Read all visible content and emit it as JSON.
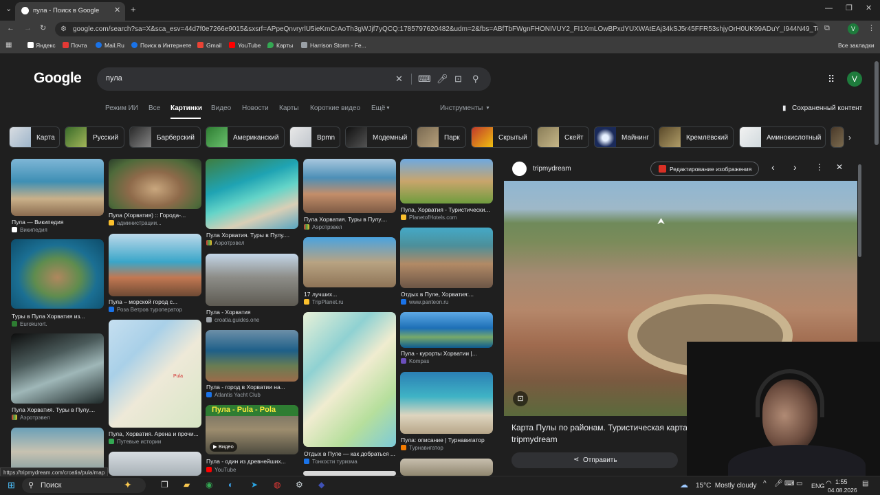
{
  "browser": {
    "tab_title": "пула - Поиск в Google",
    "url": "google.com/search?sa=X&sca_esv=44d7f0e7266e9015&sxsrf=APpeQnvryrlU5ieKmCrAoTh3gWJjf7yQCQ:1785797620482&udm=2&fbs=ABfTbFWgnFHONIVUY2_FI1XmLOwBPxdYUXWAtEAj34kSJ5r45FFR53shjyOrH0UK99ADuY_I944N49_ToyGoquklx6RmNs...",
    "bookmarks": [
      "Яндекс",
      "Почта",
      "Mail.Ru",
      "Поиск в Интернете",
      "Gmail",
      "YouTube",
      "Карты",
      "Harrison Storm - Fe..."
    ],
    "all_bookmarks": "Все закладки",
    "avatar_letter": "V"
  },
  "search": {
    "logo": "Google",
    "query": "пула",
    "tabs": [
      "Режим ИИ",
      "Все",
      "Картинки",
      "Видео",
      "Новости",
      "Карты",
      "Короткие видео",
      "Ещё"
    ],
    "tools": "Инструменты",
    "saved": "Сохраненный контент",
    "chips": [
      "Карта",
      "Русский",
      "Барберский",
      "Американский",
      "Bpmn",
      "Модемный",
      "Парк",
      "Скрытый",
      "Скейт",
      "Майнинг",
      "Кремлёвский",
      "Аминокислотный"
    ]
  },
  "results": [
    {
      "cap": "Пула — Википедия",
      "src": "Википедия"
    },
    {
      "cap": "Туры в Пула Хорватия из...",
      "src": "Eurokurort."
    },
    {
      "cap": "Пула Хорватия. Туры в Пулу....",
      "src": "Аэротрэвел"
    },
    {
      "cap": "Пула (Хорватия) :: Города-...",
      "src": "администрации..."
    },
    {
      "cap": "Пула – морской город с...",
      "src": "Роза Ветров туроператор"
    },
    {
      "cap": "Пула, Хорватия. Арена и прочи...",
      "src": "Путевые истории"
    },
    {
      "cap": "Пула Хорватия. Туры в Пулу....",
      "src": "Аэротрэвел"
    },
    {
      "cap": "Пула - Хорватия",
      "src": "croatia.guides.one"
    },
    {
      "cap": "Пула - город в Хорватии на...",
      "src": "Atlantis Yacht Club"
    },
    {
      "cap": "Пула - один из древнейшиx...",
      "src": "YouTube"
    },
    {
      "cap": "Пула Хорватия. Туры в Пулу....",
      "src": "Аэротрэвел"
    },
    {
      "cap": "17 лучших...",
      "src": "TripPlanet.ru"
    },
    {
      "cap": "Отдых в Пуле — как добраться ...",
      "src": "Тонкости туризма"
    },
    {
      "cap": "Пула, Хорватия - Туристически...",
      "src": "PlanetofHotels.com"
    },
    {
      "cap": "Отдых в Пуле, Хорватия:...",
      "src": "www.panteon.ru"
    },
    {
      "cap": "Пула - курорты Хорватии |...",
      "src": "Kompas"
    },
    {
      "cap": "Пула: описание | Турнавигатор",
      "src": "Турнавигатор"
    }
  ],
  "overlays": {
    "map_label": "Pula",
    "banner": "Пула - Pula - Pola",
    "video": "Видео"
  },
  "panel": {
    "site": "tripmydream",
    "edit": "Редактирование изображения",
    "title": "Карта Пулы по районам. Туристическая карта",
    "subtitle": "tripmydream",
    "share": "Отправить"
  },
  "status_url": "https://tripmydream.com/croatia/pula/map",
  "taskbar": {
    "search": "Поиск",
    "weather": "15°C  Mostly cloudy",
    "lang": "ENG",
    "time": "1:55",
    "date": "04.08.2026"
  }
}
